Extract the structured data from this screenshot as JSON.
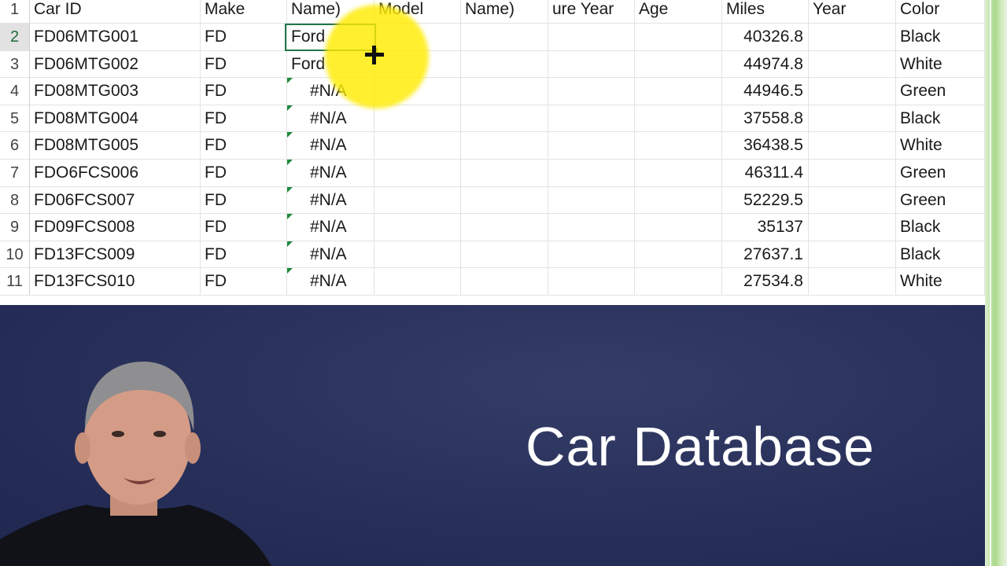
{
  "sheet": {
    "columns": [
      "Car ID",
      "Make",
      "Name)",
      "Model",
      "Name)",
      "ure Year",
      "Age",
      "Miles",
      "Year",
      "Color"
    ],
    "header_row_num": "1",
    "rows": [
      {
        "num": "2",
        "car_id": "FD06MTG001",
        "make": "FD",
        "name": "Ford",
        "miles": "40326.8",
        "color": "Black"
      },
      {
        "num": "3",
        "car_id": "FD06MTG002",
        "make": "FD",
        "name": "Ford",
        "miles": "44974.8",
        "color": "White"
      },
      {
        "num": "4",
        "car_id": "FD08MTG003",
        "make": "FD",
        "name": "#N/A",
        "miles": "44946.5",
        "color": "Green"
      },
      {
        "num": "5",
        "car_id": "FD08MTG004",
        "make": "FD",
        "name": "#N/A",
        "miles": "37558.8",
        "color": "Black"
      },
      {
        "num": "6",
        "car_id": "FD08MTG005",
        "make": "FD",
        "name": "#N/A",
        "miles": "36438.5",
        "color": "White"
      },
      {
        "num": "7",
        "car_id": "FDO6FCS006",
        "make": "FD",
        "name": "#N/A",
        "miles": "46311.4",
        "color": "Green"
      },
      {
        "num": "8",
        "car_id": "FD06FCS007",
        "make": "FD",
        "name": "#N/A",
        "miles": "52229.5",
        "color": "Green"
      },
      {
        "num": "9",
        "car_id": "FD09FCS008",
        "make": "FD",
        "name": "#N/A",
        "miles": "35137",
        "color": "Black"
      },
      {
        "num": "10",
        "car_id": "FD13FCS009",
        "make": "FD",
        "name": "#N/A",
        "miles": "27637.1",
        "color": "Black"
      },
      {
        "num": "11",
        "car_id": "FD13FCS010",
        "make": "FD",
        "name": "#N/A",
        "miles": "27534.8",
        "color": "White"
      }
    ],
    "accent_color": "#21764a",
    "error_triangle_color": "#1e8a3e"
  },
  "banner": {
    "title": "Car Database",
    "background_color": "#28305a"
  }
}
